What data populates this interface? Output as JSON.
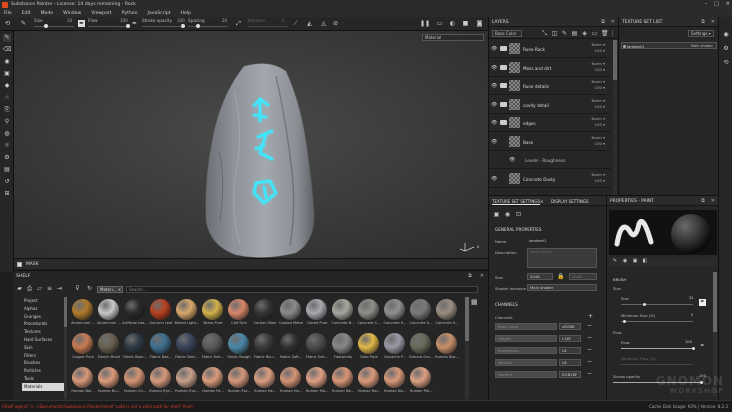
{
  "window": {
    "title": "Substance Painter - License: 14 days remaining - Rock",
    "controls": [
      "–",
      "□",
      "✕"
    ]
  },
  "menu": [
    "File",
    "Edit",
    "Mode",
    "Window",
    "Viewport",
    "Python",
    "JavaScript",
    "Help"
  ],
  "toolbar": {
    "size_label": "Size",
    "size_value": "10",
    "flow_label": "Flow",
    "flow_value": "100",
    "stroke_opacity_label": "Stroke opacity",
    "stroke_opacity_value": "100",
    "spacing_label": "Spacing",
    "spacing_value": "20",
    "rotation_label": "Rotation",
    "rotation_value": "0"
  },
  "viewport": {
    "channel_select": "Material",
    "axis_label": "x"
  },
  "mask": {
    "label": "MASK"
  },
  "shelf": {
    "title": "SHELF",
    "filter_chip": "Materi...",
    "search_placeholder": "Search...",
    "categories": [
      "Project",
      "Alphas",
      "Grunges",
      "Procedurals",
      "Textures",
      "Hard Surfaces",
      "Skin",
      "Filters",
      "Brushes",
      "Particles",
      "Tools",
      "Materials"
    ],
    "selected_category": "Materials",
    "materials": [
      {
        "name": "Aluminium ...",
        "color": "#b07a2a"
      },
      {
        "name": "Aluminium ...",
        "color": "#c8c8c8"
      },
      {
        "name": "Artificial Lea...",
        "color": "#2a2a2a"
      },
      {
        "name": "Autumn Leaf",
        "color": "#b8401e"
      },
      {
        "name": "Baked Light...",
        "color": "#d8a86a"
      },
      {
        "name": "Brass Pure",
        "color": "#d2b04a"
      },
      {
        "name": "Calf Skin",
        "color": "#d8876a"
      },
      {
        "name": "Carbon Fiber",
        "color": "#333333"
      },
      {
        "name": "Coated Metal",
        "color": "#8a8a8a"
      },
      {
        "name": "Cobalt Pure",
        "color": "#a8a8b0"
      },
      {
        "name": "Concrete B...",
        "color": "#a8a8a0"
      },
      {
        "name": "Concrete C...",
        "color": "#8e8e88"
      },
      {
        "name": "Concrete S...",
        "color": "#909090"
      },
      {
        "name": "Concrete S...",
        "color": "#7a7a7a"
      },
      {
        "name": "Concrete S...",
        "color": "#9a8e80"
      },
      {
        "name": "Copper Pure",
        "color": "#c87a52"
      },
      {
        "name": "Denim Rivet",
        "color": "#6a6050"
      },
      {
        "name": "Fabric Bam...",
        "color": "#2e3a44"
      },
      {
        "name": "Fabric Bas...",
        "color": "#3e6e8e"
      },
      {
        "name": "Fabric Deni...",
        "color": "#38445a"
      },
      {
        "name": "Fabric Knit...",
        "color": "#5a5a5a"
      },
      {
        "name": "Fabric Rough",
        "color": "#4a88a8"
      },
      {
        "name": "Fabric Rou...",
        "color": "#3a3a3a"
      },
      {
        "name": "Fabric Soft...",
        "color": "#303030"
      },
      {
        "name": "Fabric Suit...",
        "color": "#4a4a4a"
      },
      {
        "name": "Footprints",
        "color": "#888888"
      },
      {
        "name": "Gold Pure",
        "color": "#e2b848"
      },
      {
        "name": "Gouache P...",
        "color": "#9a9aa8"
      },
      {
        "name": "Ground Gra...",
        "color": "#6a6a5a"
      },
      {
        "name": "Human Bac...",
        "color": "#c8906a"
      },
      {
        "name": "Human Bel...",
        "color": "#d89878"
      },
      {
        "name": "Human Bu...",
        "color": "#dc9a7a"
      },
      {
        "name": "Human Ch...",
        "color": "#d49474"
      },
      {
        "name": "Human Eye...",
        "color": "#d89a7c"
      },
      {
        "name": "Human Eye...",
        "color": "#c8a08a"
      },
      {
        "name": "Human Fe...",
        "color": "#da9c7c"
      },
      {
        "name": "Human For...",
        "color": "#d6977a"
      },
      {
        "name": "Human He...",
        "color": "#dc9e80"
      },
      {
        "name": "Human He...",
        "color": "#d69476"
      },
      {
        "name": "Human Mo...",
        "color": "#e0a084"
      },
      {
        "name": "Human Ne...",
        "color": "#d89676"
      },
      {
        "name": "Human No...",
        "color": "#dc9a7c"
      },
      {
        "name": "Human No...",
        "color": "#d89878"
      },
      {
        "name": "Human Pal...",
        "color": "#dca082"
      }
    ]
  },
  "layers": {
    "title": "LAYERS",
    "blend_mode": "Base Color",
    "items": [
      {
        "name": "Rune Rock",
        "blend": "Norm",
        "opacity": "100",
        "type": "group"
      },
      {
        "name": "Moss and dirt",
        "blend": "Norm",
        "opacity": "100",
        "type": "group"
      },
      {
        "name": "Rune details",
        "blend": "Norm",
        "opacity": "100",
        "type": "group"
      },
      {
        "name": "cavity detail",
        "blend": "Norm",
        "opacity": "100",
        "type": "group"
      },
      {
        "name": "edges",
        "blend": "Norm",
        "opacity": "100",
        "type": "group"
      },
      {
        "name": "Base",
        "blend": "Norm",
        "opacity": "100",
        "type": "layer"
      },
      {
        "name": "Levels - Roughness",
        "blend": "",
        "opacity": "",
        "type": "effect"
      },
      {
        "name": "Concrete Dusty",
        "blend": "Norm",
        "opacity": "100",
        "type": "layer"
      }
    ]
  },
  "texture_set_list": {
    "title": "TEXTURE SET LIST",
    "settings_label": "Settings ▾",
    "item_name": "lambert1",
    "item_shader": "Main shader"
  },
  "tss": {
    "tab1": "TEXTURE SET SETTINGS",
    "tab2": "DISPLAY SETTINGS",
    "general": "GENERAL PROPERTIES",
    "name_label": "Name",
    "name_value": "lambert1",
    "desc_label": "Description",
    "desc_placeholder": "Description",
    "size_label": "Size",
    "size_value": "2048",
    "size_value2": "2048",
    "shader_label": "Shader Instance",
    "shader_value": "Main shader",
    "channels_title": "CHANNELS",
    "channels_label": "Channels",
    "channels": [
      {
        "name": "Base Color",
        "format": "sRGB8"
      },
      {
        "name": "Height",
        "format": "L16F"
      },
      {
        "name": "Roughness",
        "format": "L8"
      },
      {
        "name": "Metallic",
        "format": "L8"
      },
      {
        "name": "Normal",
        "format": "RGB16F"
      }
    ]
  },
  "props": {
    "title": "PROPERTIES - PAINT",
    "brush": "BRUSH",
    "size_label": "Size",
    "size_value": "32",
    "min_size_label": "Minimum Size (%)",
    "min_size_value": "5",
    "flow_section": "Flow",
    "flow_label": "Flow",
    "flow_value": "100",
    "min_flow_label": "Minimum Flow (%)",
    "stroke_opacity_label": "Stroke opacity",
    "stroke_opacity_value": "100"
  },
  "status": {
    "error": "[Shelf agent] '\\\\...\\\\Documents\\\\Substance Painter\\\\shelf' path is not a valid path for shelf 'Yesm'",
    "cache": "Cache Disk Usage: 93% | Version: 8.2.3"
  },
  "watermark": {
    "line1": "GNOMON",
    "line2": "WORKSHOP"
  },
  "colors": {
    "rune_glow": "#3ee8ff",
    "error_text": "#d23c2c",
    "accent": "#e04a1f"
  }
}
